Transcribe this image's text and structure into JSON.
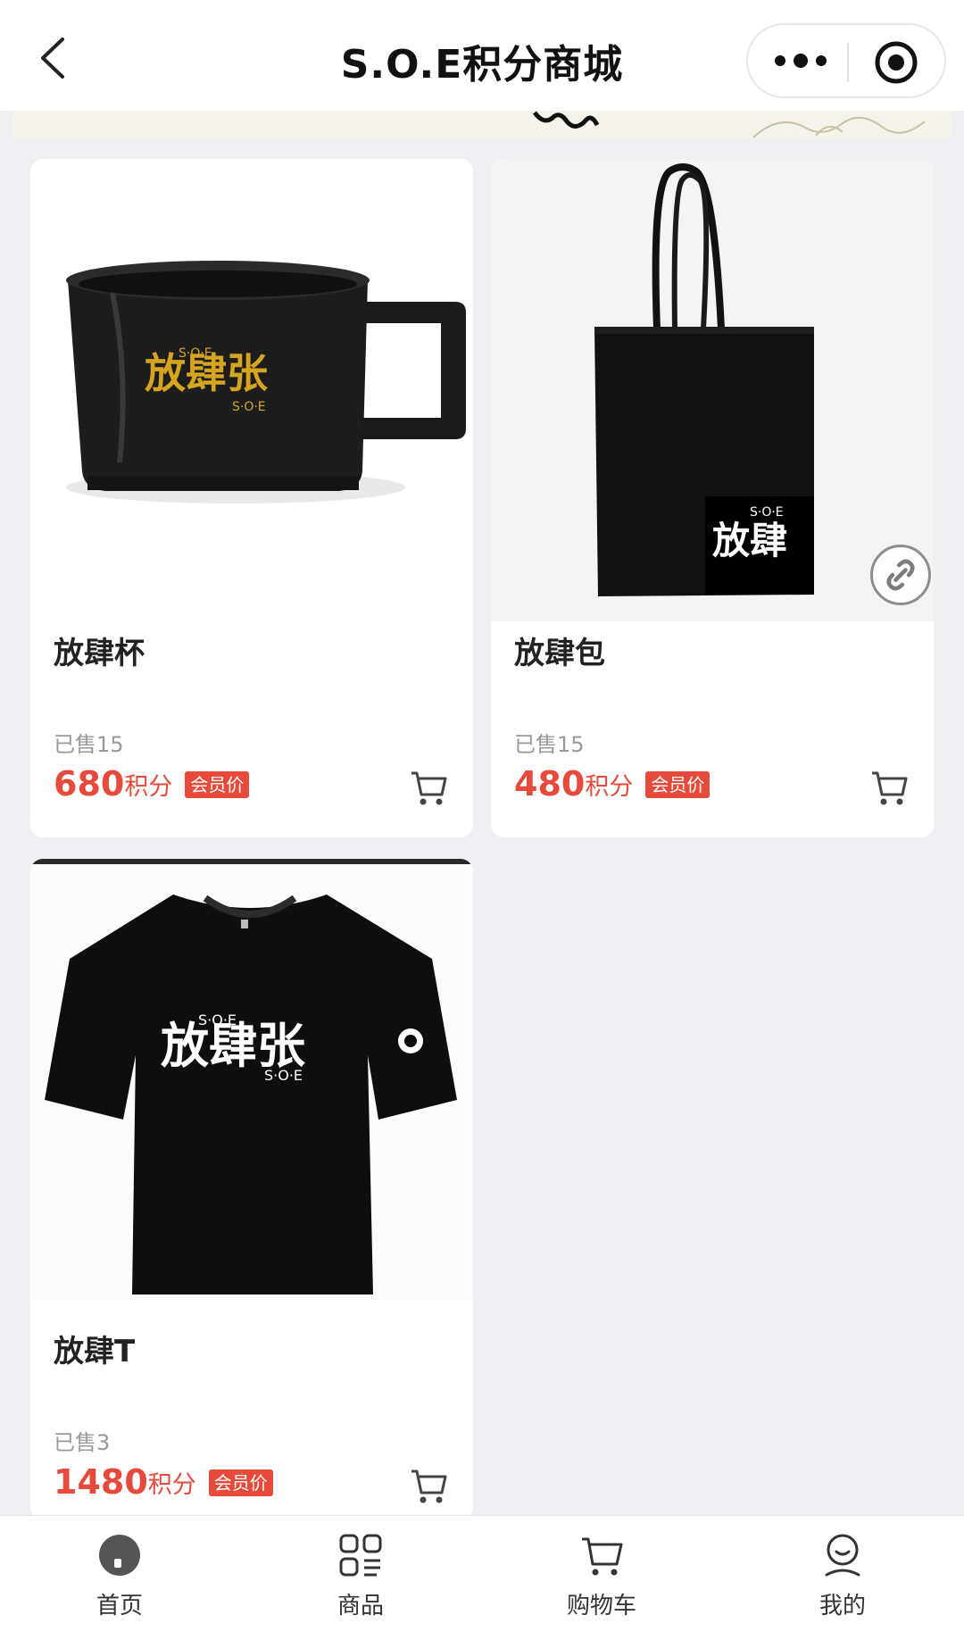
{
  "header": {
    "title": "S.O.E积分商城"
  },
  "icons": {
    "back": "chevron-left-icon",
    "more": "more-dots-icon",
    "close": "target-close-icon",
    "cart": "cart-icon",
    "link": "link-icon"
  },
  "colors": {
    "accent": "#e64a3b",
    "background": "#efeff4"
  },
  "products": [
    {
      "name": "放肆杯",
      "sold": "已售15",
      "price": "680",
      "unit": "积分",
      "badge": "会员价",
      "image": "black mug with gold calligraphy"
    },
    {
      "name": "放肆包",
      "sold": "已售15",
      "price": "480",
      "unit": "积分",
      "badge": "会员价",
      "image": "black tote bag"
    },
    {
      "name": "放肆T",
      "sold": "已售3",
      "price": "1480",
      "unit": "积分",
      "badge": "会员价",
      "image": "black t-shirt"
    }
  ],
  "tabbar": {
    "items": [
      {
        "label": "首页",
        "icon": "home-icon",
        "active": true
      },
      {
        "label": "商品",
        "icon": "grid-list-icon",
        "active": false
      },
      {
        "label": "购物车",
        "icon": "cart-icon",
        "active": false
      },
      {
        "label": "我的",
        "icon": "user-icon",
        "active": false
      }
    ]
  }
}
